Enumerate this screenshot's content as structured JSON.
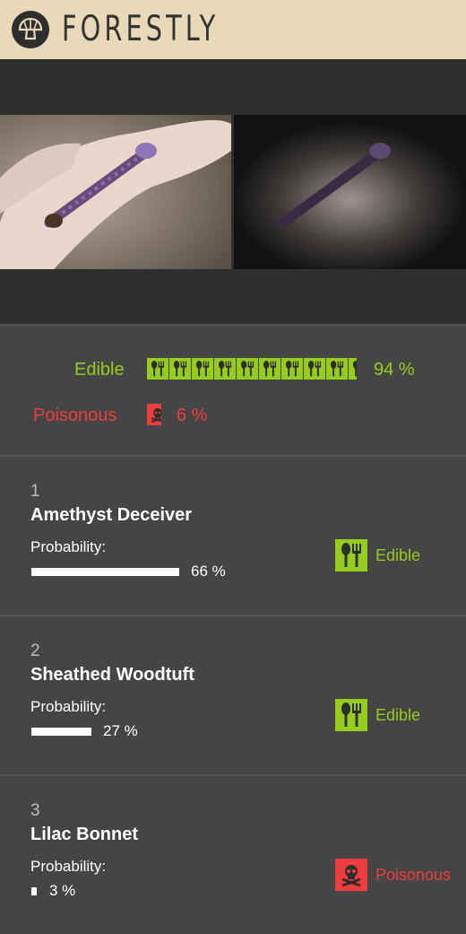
{
  "app": {
    "title": "FORESTLY",
    "logo_icon": "mushroom-icon"
  },
  "images": {
    "left": "mushroom photo",
    "right": "mushroom photo with attention overlay"
  },
  "summary": {
    "edible_label": "Edible",
    "edible_pct": "94 %",
    "edible_value": 0.94,
    "poisonous_label": "Poisonous",
    "poisonous_pct": "6 %",
    "poisonous_value": 0.06,
    "colors": {
      "edible": "#96cc1c",
      "poisonous": "#ef3d3d"
    }
  },
  "results": [
    {
      "rank": "1",
      "name": "Amethyst Deceiver",
      "prob_label": "Probability:",
      "prob_pct": "66 %",
      "prob_value": 0.66,
      "class": "Edible",
      "icon": "cutlery-icon"
    },
    {
      "rank": "2",
      "name": "Sheathed Woodtuft",
      "prob_label": "Probability:",
      "prob_pct": "27 %",
      "prob_value": 0.27,
      "class": "Edible",
      "icon": "cutlery-icon"
    },
    {
      "rank": "3",
      "name": "Lilac Bonnet",
      "prob_label": "Probability:",
      "prob_pct": "3 %",
      "prob_value": 0.03,
      "class": "Poisonous",
      "icon": "skull-icon"
    }
  ]
}
